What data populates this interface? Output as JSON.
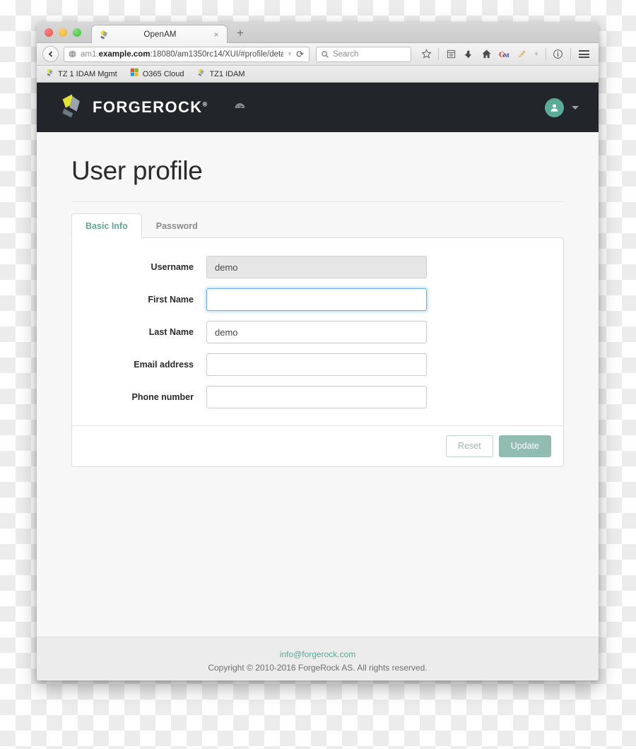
{
  "browser": {
    "tab": {
      "title": "OpenAM",
      "close_label": "×",
      "favicon": "forgerock-favicon"
    },
    "new_tab_label": "+",
    "url": {
      "host_prefix": "am1.",
      "host_bold": "example.com",
      "path": ":18080/am1350rc14/XUI/#profile/deta"
    },
    "reload_label": "⟳",
    "search": {
      "placeholder": "Search"
    },
    "toolbar_icons": [
      "star-icon",
      "reading-list-icon",
      "downloads-icon",
      "home-icon",
      "gm-extension-icon",
      "broom-extension-icon",
      "chevron-down-icon",
      "info-icon",
      "menu-icon"
    ],
    "bookmarks": [
      {
        "label": "TZ 1 IDAM Mgmt",
        "icon": "forgerock-favicon"
      },
      {
        "label": "O365 Cloud",
        "icon": "microsoft-icon"
      },
      {
        "label": "TZ1 IDAM",
        "icon": "forgerock-favicon"
      }
    ]
  },
  "header": {
    "brand": "FORGEROCK",
    "brand_mark": "®",
    "dashboard_icon": "dashboard-icon",
    "avatar_icon": "user-avatar-icon",
    "brand_dark": "#22262a",
    "accent": "#5ba894"
  },
  "main": {
    "title": "User profile",
    "tabs": [
      {
        "label": "Basic Info",
        "active": true
      },
      {
        "label": "Password",
        "active": false
      }
    ],
    "fields": [
      {
        "label": "Username",
        "value": "demo",
        "placeholder": "",
        "state": "readonly"
      },
      {
        "label": "First Name",
        "value": "",
        "placeholder": "",
        "state": "focused"
      },
      {
        "label": "Last Name",
        "value": "demo",
        "placeholder": "",
        "state": "normal"
      },
      {
        "label": "Email address",
        "value": "",
        "placeholder": "",
        "state": "normal"
      },
      {
        "label": "Phone number",
        "value": "",
        "placeholder": "",
        "state": "normal"
      }
    ],
    "buttons": {
      "reset": "Reset",
      "update": "Update"
    }
  },
  "footer": {
    "email": "info@forgerock.com",
    "copyright": "Copyright © 2010-2016 ForgeRock AS. All rights reserved."
  }
}
